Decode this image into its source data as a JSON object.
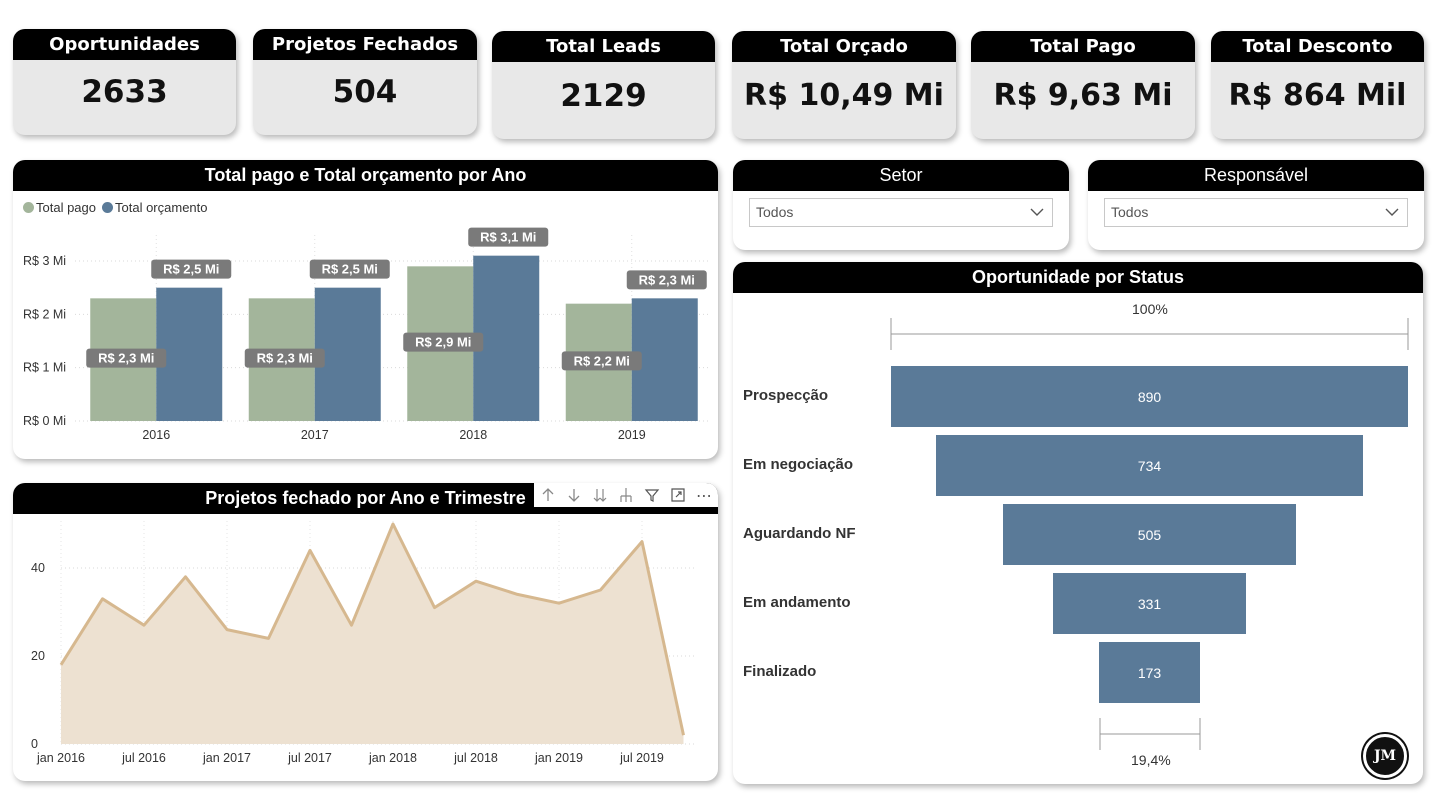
{
  "kpis": [
    {
      "label": "Oportunidades",
      "value": "2633"
    },
    {
      "label": "Projetos Fechados",
      "value": "504"
    },
    {
      "label": "Total Leads",
      "value": "2129"
    },
    {
      "label": "Total Orçado",
      "value": "R$ 10,49 Mi"
    },
    {
      "label": "Total Pago",
      "value": "R$ 9,63 Mi"
    },
    {
      "label": "Total Desconto",
      "value": "R$ 864 Mil"
    }
  ],
  "bar_panel": {
    "title": "Total pago e Total orçamento por Ano",
    "legend": [
      "Total pago",
      "Total orçamento"
    ]
  },
  "line_panel": {
    "title": "Projetos fechado por Ano e Trimestre"
  },
  "slicers": {
    "setor": {
      "label": "Setor",
      "value": "Todos"
    },
    "responsavel": {
      "label": "Responsável",
      "value": "Todos"
    }
  },
  "funnel_panel": {
    "title": "Oportunidade por Status",
    "top_pct": "100%",
    "bottom_pct": "19,4%",
    "logo_text": "JM"
  },
  "colors": {
    "total_pago": "#a3b59b",
    "total_orcamento": "#5a7a98",
    "line_stroke": "#d6b88f",
    "line_fill": "#ede1d1",
    "funnel": "#5a7a98"
  },
  "icons": [
    "arrow-up-icon",
    "arrow-down-icon",
    "double-arrow-down-icon",
    "drill-down-icon",
    "filter-icon",
    "focus-mode-icon",
    "more-options-icon",
    "chevron-down-icon"
  ],
  "chart_data": [
    {
      "type": "bar",
      "title": "Total pago e Total orçamento por Ano",
      "categories": [
        "2016",
        "2017",
        "2018",
        "2019"
      ],
      "series": [
        {
          "name": "Total pago",
          "values": [
            2.3,
            2.3,
            2.9,
            2.2
          ],
          "labels": [
            "R$ 2,3 Mi",
            "R$ 2,3 Mi",
            "R$ 2,9 Mi",
            "R$ 2,2 Mi"
          ]
        },
        {
          "name": "Total orçamento",
          "values": [
            2.5,
            2.5,
            3.1,
            2.3
          ],
          "labels": [
            "R$ 2,5 Mi",
            "R$ 2,5 Mi",
            "R$ 3,1 Mi",
            "R$ 2,3 Mi"
          ]
        }
      ],
      "yticks": [
        "R$ 0 Mi",
        "R$ 1 Mi",
        "R$ 2 Mi",
        "R$ 3 Mi"
      ],
      "ylim": [
        0,
        3
      ],
      "grid": true,
      "legend": "top-left"
    },
    {
      "type": "area",
      "title": "Projetos fechado por Ano e Trimestre",
      "x": [
        "2016-01",
        "2016-04",
        "2016-07",
        "2016-10",
        "2017-01",
        "2017-04",
        "2017-07",
        "2017-10",
        "2018-01",
        "2018-04",
        "2018-07",
        "2018-10",
        "2019-01",
        "2019-04",
        "2019-07",
        "2019-10"
      ],
      "values": [
        18,
        33,
        27,
        38,
        26,
        24,
        44,
        27,
        50,
        31,
        37,
        34,
        32,
        35,
        46,
        2
      ],
      "xticks": [
        "jan 2016",
        "jul 2016",
        "jan 2017",
        "jul 2017",
        "jan 2018",
        "jul 2018",
        "jan 2019",
        "jul 2019"
      ],
      "yticks": [
        "0",
        "20",
        "40"
      ],
      "ylim": [
        0,
        50
      ],
      "grid": true
    },
    {
      "type": "bar",
      "title": "Oportunidade por Status",
      "categories": [
        "Prospecção",
        "Em negociação",
        "Aguardando NF",
        "Em andamento",
        "Finalizado"
      ],
      "values": [
        890,
        734,
        505,
        331,
        173
      ]
    }
  ]
}
